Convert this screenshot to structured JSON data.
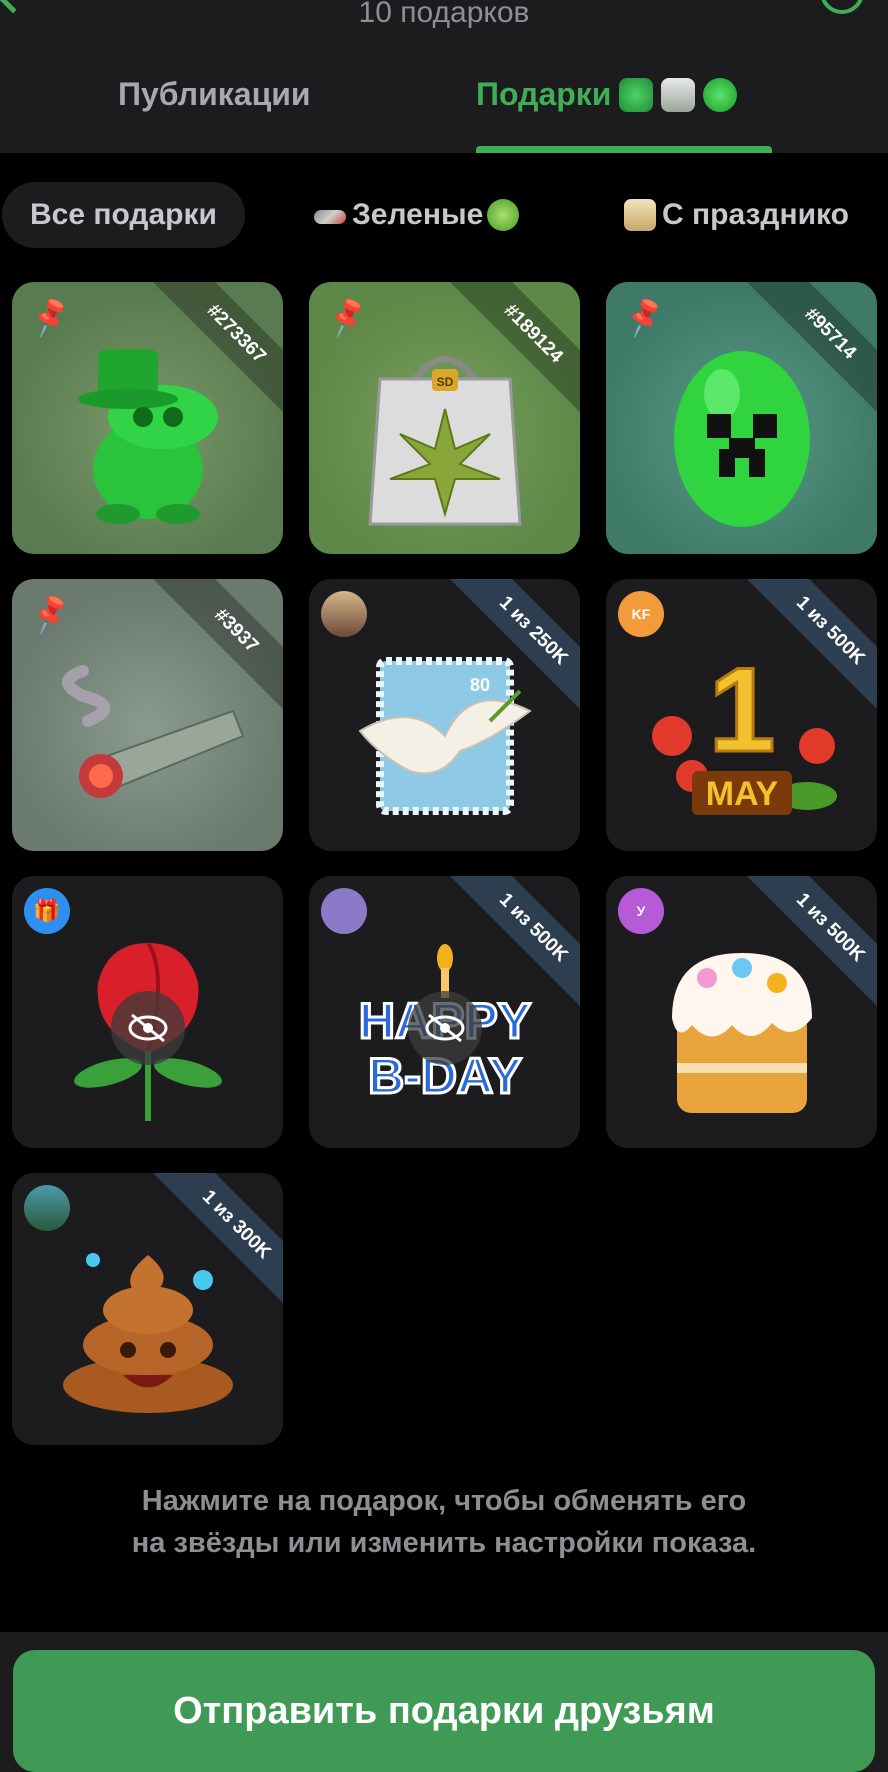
{
  "header": {
    "subtitle": "10 подарков"
  },
  "tabs": [
    {
      "label": "Публикации",
      "active": false
    },
    {
      "label": "Подарки",
      "active": true
    }
  ],
  "filters": [
    {
      "label": "Все подарки",
      "active": true
    },
    {
      "label": "Зеленые",
      "active": false
    },
    {
      "label": "С празднико",
      "active": false
    }
  ],
  "gifts": [
    {
      "name": "green-dino",
      "badge": "#273367",
      "pinned": true
    },
    {
      "name": "weed-bag",
      "badge": "#189124",
      "pinned": true
    },
    {
      "name": "creeper-egg",
      "badge": "#95714",
      "pinned": true
    },
    {
      "name": "money-joint",
      "badge": "#3937",
      "pinned": true
    },
    {
      "name": "dove-stamp",
      "badge": "1 из 250K",
      "sender": ""
    },
    {
      "name": "may-first",
      "badge": "1 из 500K",
      "sender": "KF"
    },
    {
      "name": "red-rose",
      "badge": "",
      "sender": "",
      "hidden": true
    },
    {
      "name": "happy-bday",
      "badge": "1 из 500K",
      "sender": "",
      "hidden": true
    },
    {
      "name": "easter-cake",
      "badge": "1 из 500K",
      "sender": "У"
    },
    {
      "name": "poop-emoji",
      "badge": "1 из 300K",
      "sender": ""
    }
  ],
  "artwork_text": {
    "dove_stamp_value": "80",
    "may_number": "1",
    "may_label": "MAY",
    "bag_logo": "SD",
    "bday_line1": "HAPPY",
    "bday_line2": "B-DAY"
  },
  "hint": {
    "line1": "Нажмите на подарок, чтобы обменять его",
    "line2": "на звёзды или изменить настройки показа."
  },
  "footer": {
    "send_button": "Отправить подарки друзьям"
  },
  "colors": {
    "accent": "#3fae54",
    "button": "#3e9a54",
    "surface": "#1c1c1e",
    "background": "#000000",
    "ribbon": "#2c3e50"
  }
}
